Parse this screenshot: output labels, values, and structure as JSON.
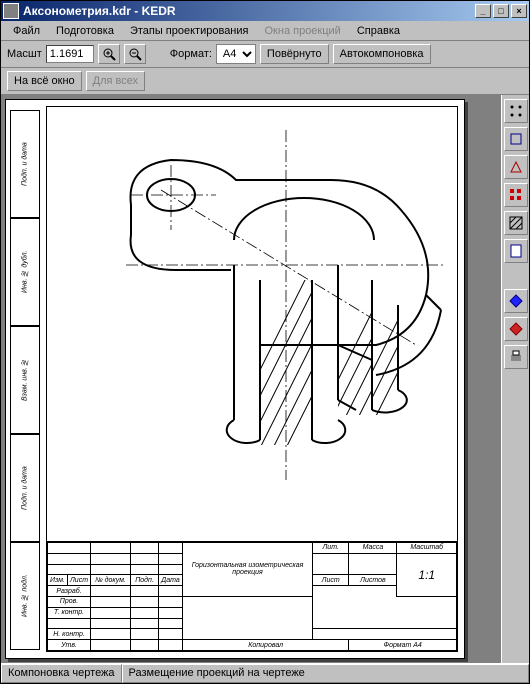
{
  "window": {
    "title": "Аксонометрия.kdr - KEDR"
  },
  "menu": {
    "file": "Файл",
    "prep": "Подготовка",
    "stages": "Этапы проектирования",
    "proj_windows": "Окна проекций",
    "help": "Справка"
  },
  "toolbar1": {
    "scale_label": "Масшт",
    "scale_value": "1.1691",
    "format_label": "Формат:",
    "format_value": "A4",
    "rotated": "Повёрнуто",
    "autolayout": "Автокомпоновка"
  },
  "toolbar2": {
    "fit_window": "На всё окно",
    "for_all": "Для всех"
  },
  "titleblock": {
    "caption": "Горизонтальная изометрическая проекция",
    "scale": "1:1",
    "row_izm": "Изм.",
    "row_list": "Лист",
    "row_ndok": "№ докум.",
    "row_podp": "Подп.",
    "row_data": "Дата",
    "row_razrab": "Разраб.",
    "row_prov": "Пров.",
    "row_tkontr": "Т. контр.",
    "row_nkontr": "Н. контр.",
    "row_utv": "Утв.",
    "lit": "Лит.",
    "massa": "Масса",
    "masht": "Масштаб",
    "list": "Лист",
    "listov": "Листов",
    "kopiroval": "Копировал",
    "format_a4": "Формат A4"
  },
  "sideblock": {
    "c1": "Подп. и дата",
    "c2": "Инв. № дубл.",
    "c3": "Взам. инв. №",
    "c4": "Подп. и дата",
    "c5": "Инв. № подл."
  },
  "status": {
    "cell1": "Компоновка чертежа",
    "cell2": "Размещение проекций на чертеже"
  },
  "side_icons": {
    "i1": "tool-1",
    "i2": "tool-2",
    "i3": "tool-3",
    "i4": "tool-4",
    "i5": "tool-5",
    "i6": "tool-6",
    "i7": "tool-7",
    "i8": "tool-8",
    "i9": "tool-9"
  }
}
